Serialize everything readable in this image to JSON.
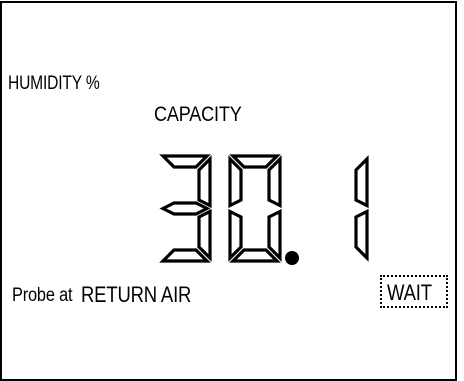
{
  "display": {
    "humidity_label": "HUMIDITY %",
    "mode_label": "CAPACITY",
    "value": "30.1",
    "probe_label": "Probe at",
    "probe_location": "RETURN AIR",
    "status_badge": "WAIT"
  },
  "colors": {
    "background": "#ffffff",
    "foreground": "#000000"
  }
}
